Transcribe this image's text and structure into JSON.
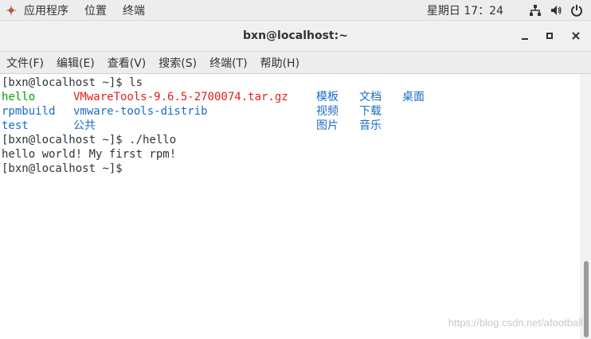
{
  "topbar": {
    "applications": "应用程序",
    "places": "位置",
    "terminal": "终端",
    "clock": "星期日 17：24"
  },
  "window": {
    "title": "bxn@localhost:~",
    "buttons": [
      "minimize-icon",
      "maximize-icon",
      "close-icon"
    ]
  },
  "menubar": {
    "file": "文件(F)",
    "edit": "编辑(E)",
    "view": "查看(V)",
    "search": "搜索(S)",
    "terminal": "终端(T)",
    "help": "帮助(H)"
  },
  "terminal": {
    "line1": "[bxn@localhost ~]$ ls",
    "ls": {
      "c1": [
        "hello",
        "rpmbuild",
        "test"
      ],
      "c2": [
        "VMwareTools-9.6.5-2700074.tar.gz",
        "vmware-tools-distrib",
        "公共"
      ],
      "c3": [
        "模板",
        "视频",
        "图片"
      ],
      "c4": [
        "文档",
        "下载",
        "音乐"
      ],
      "c5": [
        "桌面"
      ]
    },
    "line5": "[bxn@localhost ~]$ ./hello",
    "line6": "hello world! My first rpm!",
    "line7": "[bxn@localhost ~]$"
  },
  "watermark": "https://blog.csdn.net/afootball",
  "colors": {
    "executable": "#00a000",
    "archive": "#e02020",
    "directory": "#1a6cc8"
  }
}
